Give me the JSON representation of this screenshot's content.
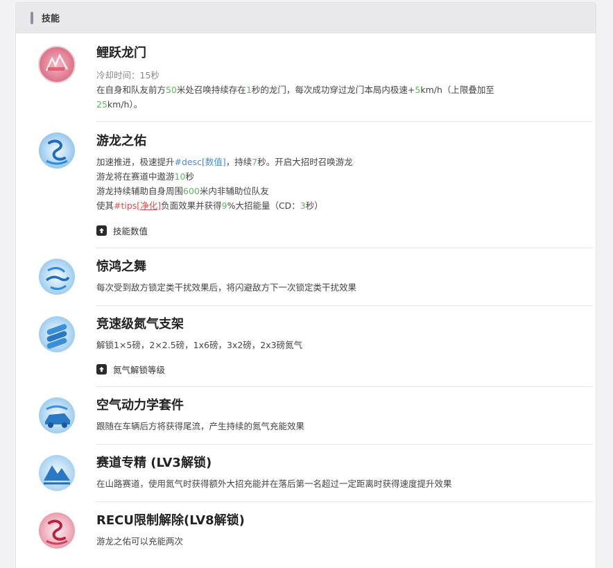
{
  "header": {
    "title": "技能"
  },
  "skills": [
    {
      "name": "鲤跃龙门",
      "icon": "carp-dragon-gate-icon",
      "cooldown": "冷却时间：15秒",
      "desc": [
        [
          "在自身和队友前方",
          "50",
          "米处召唤持续存在",
          "1",
          "秒的龙门，每次成功穿过龙门本局内极速+",
          "5",
          "km/h（上限叠加至"
        ],
        [
          "25",
          "km/h）。"
        ]
      ]
    },
    {
      "name": "游龙之佑",
      "icon": "dragon-blessing-icon",
      "desc": [
        [
          "加速推进，极速提升",
          "#desc[数值]",
          "，持续",
          "7",
          "秒。开启大招时召唤游龙"
        ],
        [
          "游龙将在赛道中遨游",
          "10",
          "秒"
        ],
        [
          "游龙持续辅助自身周围",
          "600",
          "米内非辅助位队友"
        ],
        [
          "使其",
          "#tips[",
          "净化",
          "]",
          "负面效果并获得",
          "9",
          "%大招能量（CD：",
          "3",
          "秒）"
        ]
      ],
      "expander": "技能数值"
    },
    {
      "name": "惊鸿之舞",
      "icon": "swift-dance-icon",
      "desc": [
        [
          "每次受到敌方锁定类干扰效果后，将闪避敌方下一次锁定类干扰效果"
        ]
      ]
    },
    {
      "name": "竞速级氮气支架",
      "icon": "nitro-rack-icon",
      "desc": [
        [
          "解锁1×5磅，2×2.5磅，1x6磅，3x2磅，2x3磅氮气"
        ]
      ],
      "expander": "氮气解锁等级"
    },
    {
      "name": "空气动力学套件",
      "icon": "aero-kit-icon",
      "desc": [
        [
          "跟随在车辆后方将获得尾流，产生持续的氮气充能效果"
        ]
      ]
    },
    {
      "name": "赛道专精 (LV3解锁)",
      "icon": "mountain-track-icon",
      "desc": [
        [
          "在山路赛道，使用氮气时获得额外大招充能并在落后第一名超过一定距离时获得速度提升效果"
        ]
      ]
    },
    {
      "name": "RECU限制解除(LV8解锁)",
      "icon": "limit-release-icon",
      "desc": [
        [
          "游龙之佑可以充能两次"
        ]
      ]
    }
  ]
}
